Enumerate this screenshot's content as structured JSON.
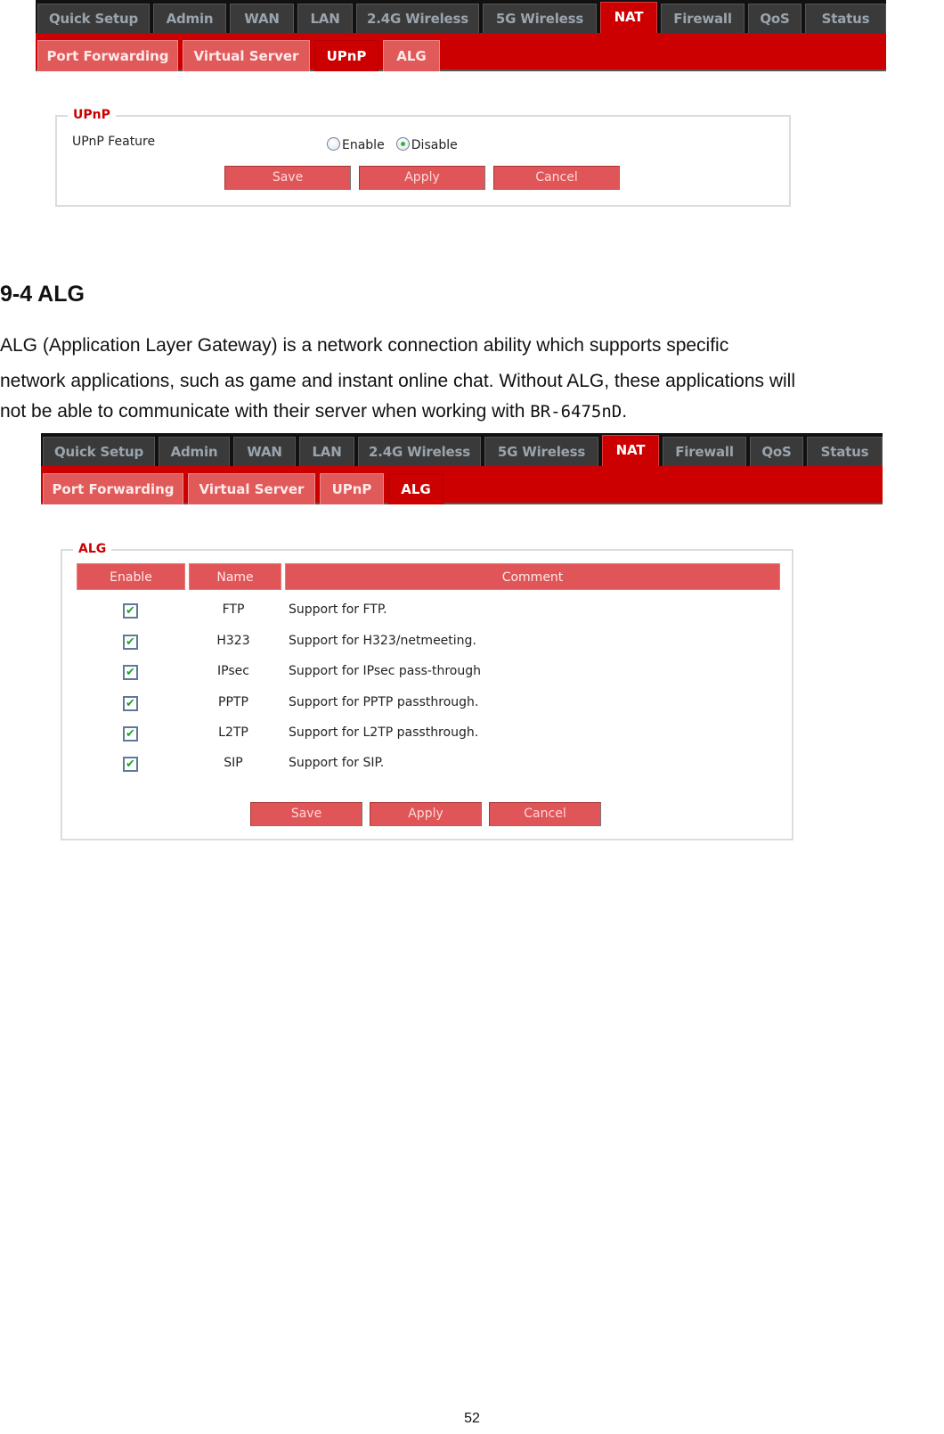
{
  "upnp_screenshot": {
    "main_tabs": [
      "Quick Setup",
      "Admin",
      "WAN",
      "LAN",
      "2.4G Wireless",
      "5G Wireless",
      "NAT",
      "Firewall",
      "QoS",
      "Status"
    ],
    "active_main_tab": "NAT",
    "sub_tabs": [
      "Port Forwarding",
      "Virtual Server",
      "UPnP",
      "ALG"
    ],
    "active_sub_tab": "UPnP",
    "section_title": "UPnP",
    "feature_label": "UPnP Feature",
    "options": [
      {
        "label": "Enable",
        "selected": false
      },
      {
        "label": "Disable",
        "selected": true
      }
    ],
    "buttons": {
      "save": "Save",
      "apply": "Apply",
      "cancel": "Cancel"
    }
  },
  "section": {
    "heading": "9-4 ALG",
    "paragraph_lines": [
      "ALG (Application Layer Gateway) is a network connection ability which supports specific",
      "network applications, such as game and instant online chat. Without ALG, these applications will",
      "not be able to communicate with their server when working with "
    ],
    "model": "BR-6475nD",
    "trailing": "."
  },
  "alg_screenshot": {
    "main_tabs": [
      "Quick Setup",
      "Admin",
      "WAN",
      "LAN",
      "2.4G Wireless",
      "5G Wireless",
      "NAT",
      "Firewall",
      "QoS",
      "Status"
    ],
    "active_main_tab": "NAT",
    "sub_tabs": [
      "Port Forwarding",
      "Virtual Server",
      "UPnP",
      "ALG"
    ],
    "active_sub_tab": "ALG",
    "section_title": "ALG",
    "columns": [
      "Enable",
      "Name",
      "Comment"
    ],
    "rows": [
      {
        "enabled": true,
        "name": "FTP",
        "comment": "Support for FTP."
      },
      {
        "enabled": true,
        "name": "H323",
        "comment": "Support for H323/netmeeting."
      },
      {
        "enabled": true,
        "name": "IPsec",
        "comment": "Support for IPsec pass-through"
      },
      {
        "enabled": true,
        "name": "PPTP",
        "comment": "Support for PPTP passthrough."
      },
      {
        "enabled": true,
        "name": "L2TP",
        "comment": "Support for L2TP passthrough."
      },
      {
        "enabled": true,
        "name": "SIP",
        "comment": "Support for SIP."
      }
    ],
    "buttons": {
      "save": "Save",
      "apply": "Apply",
      "cancel": "Cancel"
    },
    "check_glyph": "✔"
  },
  "footer": {
    "page_number": "52"
  },
  "colors": {
    "nav_dark": "#111111",
    "accent_red": "#cc0000",
    "button_red": "#e05557",
    "legend_red": "#cc0000"
  }
}
